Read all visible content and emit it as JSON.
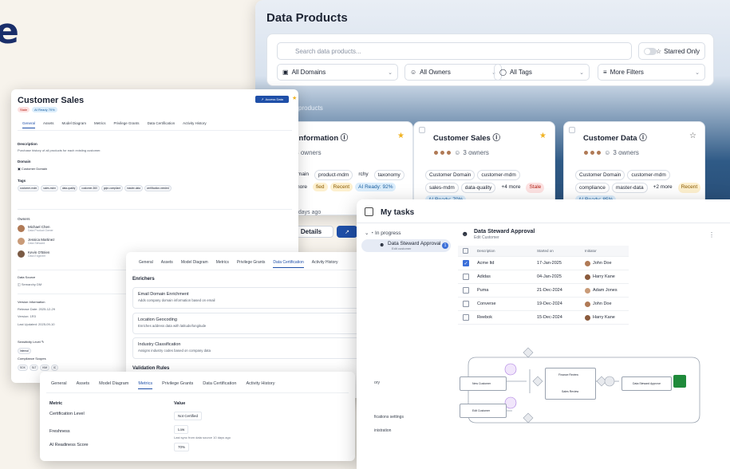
{
  "brand": {
    "glyph": "e"
  },
  "data_products": {
    "title": "Data Products",
    "search_placeholder": "Search data products...",
    "starred_label": "Starred Only",
    "filters": [
      "All Domains",
      "All Owners",
      "All Tags",
      "More Filters"
    ],
    "count_text": "3 of 3 data products",
    "cards": [
      {
        "title": "uct Information",
        "owners": "3 owners",
        "chips": [
          "t Domain",
          "product-mdm",
          "rchy",
          "taxonomy",
          "+2 more"
        ],
        "pills": [
          "fied",
          "Recent",
          "AI Ready: 92%"
        ],
        "ago": "3 days ago",
        "details": "Details"
      },
      {
        "title": "Customer Sales",
        "owners": "3 owners",
        "chips": [
          "Customer Domain",
          "customer-mdm",
          "sales-mdm",
          "data-quality",
          "+4 more"
        ],
        "pills": [
          "Stale",
          "AI Ready: 70%"
        ]
      },
      {
        "title": "Customer Data",
        "owners": "3 owners",
        "chips": [
          "Customer Domain",
          "customer-mdm",
          "compliance",
          "master-data",
          "+2 more"
        ],
        "pills": [
          "Recent",
          "AI Ready: 85%"
        ]
      }
    ]
  },
  "customer_sales": {
    "title": "Customer Sales",
    "badges": [
      "Stale",
      "AI Ready 70%"
    ],
    "access_label": "Access Data",
    "tabs": [
      "General",
      "Assets",
      "Model Diagram",
      "Metrics",
      "Privilege Grants",
      "Data Certification",
      "Activity History"
    ],
    "description_label": "Description",
    "description": "Purchase history of all products for each existing customer.",
    "domain_label": "Domain",
    "domain": "Customer Domain",
    "tags_label": "Tags",
    "tags": [
      "customer-mdm",
      "sales-mdm",
      "data-quality",
      "customer-360",
      "gdpr-compliant",
      "master-data",
      "certification-needed"
    ],
    "owners_label": "Owners",
    "owners": [
      {
        "name": "Michael Chen",
        "role": "Data Product Owner"
      },
      {
        "name": "Jessica Martinez",
        "role": "Data Steward"
      },
      {
        "name": "Kevin O'Brien",
        "role": "Data Engineer"
      }
    ],
    "source_label": "Data Source",
    "source": "Semarchy DM",
    "version_label": "Version Information",
    "release_date": "Release Date: 2025-12-29",
    "version": "Version: 1R3",
    "last_updated": "Last Updated: 2025-09-10",
    "sensitivity_label": "Sensitivity Level",
    "sensitivity": "Internal",
    "compliance_label": "Compliance Scopes",
    "compliance": [
      "SOX",
      "SLT",
      "KIM",
      "IC"
    ]
  },
  "certification": {
    "tabs": [
      "General",
      "Assets",
      "Model Diagram",
      "Metrics",
      "Privilege Grants",
      "Data Certification",
      "Activity History"
    ],
    "enrichers_label": "Enrichers",
    "enrichers": [
      {
        "name": "Email Domain Enrichment",
        "desc": "Adds company domain information based on email"
      },
      {
        "name": "Location Geocoding",
        "desc": "Enriches address data with latitude/longitude"
      },
      {
        "name": "Industry Classification",
        "desc": "Assigns industry codes based on company data"
      }
    ],
    "validation_label": "Validation Rules"
  },
  "metrics": {
    "tabs": [
      "General",
      "Assets",
      "Model Diagram",
      "Metrics",
      "Privilege Grants",
      "Data Certification",
      "Activity History"
    ],
    "header": [
      "Metric",
      "Value"
    ],
    "rows": [
      {
        "metric": "Certification Level",
        "value": "Not Certified"
      },
      {
        "metric": "Freshness",
        "value": "Low",
        "note": "Last sync from data source 10 days ago"
      },
      {
        "metric": "AI Readiness Score",
        "value": "70%"
      }
    ]
  },
  "tasks": {
    "title": "My tasks",
    "in_progress": "In progress",
    "item_name": "Data Steward Approval",
    "item_sub": "Edit customer",
    "item_count": "1",
    "side_links": [
      "ory",
      "fications settings",
      "inistration"
    ],
    "detail_title": "Data Steward Approval",
    "detail_sub": "Edit Customer",
    "columns": [
      "Description",
      "Started on",
      "Initiator"
    ],
    "rows": [
      {
        "desc": "Acme ltd",
        "date": "17-Jan-2025",
        "init": "John Doe",
        "checked": true
      },
      {
        "desc": "Adidas",
        "date": "04-Jan-2025",
        "init": "Harry Kane",
        "checked": false
      },
      {
        "desc": "Puma",
        "date": "21-Dec-2024",
        "init": "Adam Jones",
        "checked": false
      },
      {
        "desc": "Converse",
        "date": "19-Dec-2024",
        "init": "John Doe",
        "checked": false
      },
      {
        "desc": "Reebok",
        "date": "15-Dec-2024",
        "init": "Harry Kane",
        "checked": false
      }
    ],
    "flow": {
      "new_customer": "New Customer",
      "edit_customer": "Edit Customer",
      "finance_review": "Finance Review",
      "sales_review": "Sales Review",
      "steward_approve": "Data Steward Approve"
    }
  }
}
